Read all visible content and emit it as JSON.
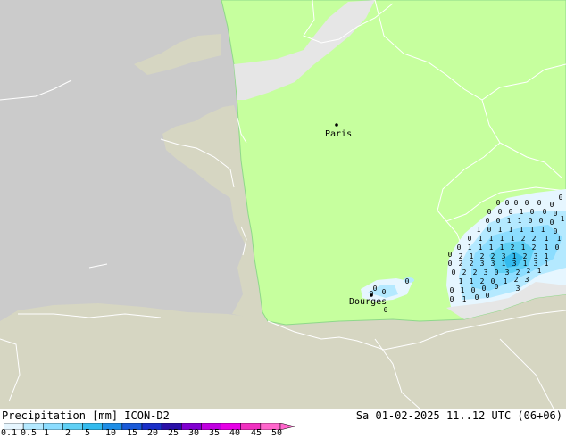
{
  "title": {
    "left": "Precipitation [mm] ICON-D2",
    "right": "Sa 01-02-2025 11..12 UTC (06+06)"
  },
  "cities": [
    {
      "name": "Paris"
    },
    {
      "name": "Dourges"
    }
  ],
  "legend": {
    "ticks": [
      "0.1",
      "0.5",
      "1",
      "2",
      "5",
      "10",
      "15",
      "20",
      "25",
      "30",
      "35",
      "40",
      "45",
      "50"
    ],
    "colors": [
      "#e6f6ff",
      "#b4e9ff",
      "#8cddff",
      "#5fd0f5",
      "#33bbee",
      "#1f8ee6",
      "#1a5ad8",
      "#1a2fc8",
      "#2a10a8",
      "#8000d0",
      "#c000e0",
      "#e600e6",
      "#f030c0",
      "#ff66cc"
    ]
  },
  "colors": {
    "land_outside": "#d6d6c2",
    "sea": "#cbcbcb",
    "model_domain": "#c6ff9e",
    "domain_edge": "#8fd88a",
    "border_lines": "#ffffff",
    "no_data": "#e6e6e6"
  }
}
